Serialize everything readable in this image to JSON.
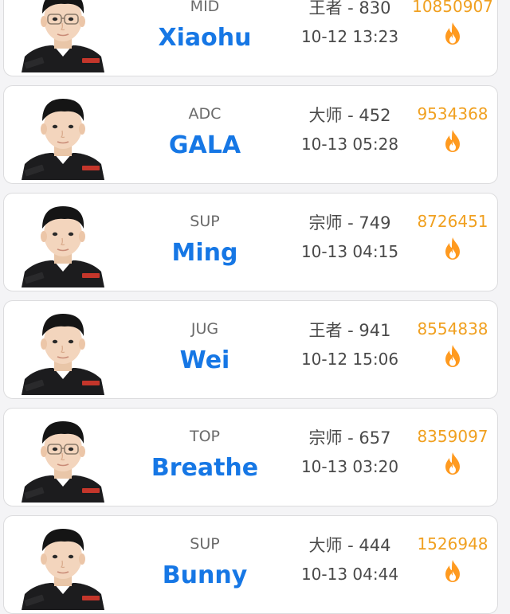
{
  "colors": {
    "name": "#1677e5",
    "score": "#f0a020",
    "fire": "#ff9a1f",
    "card_border": "#dcdcde"
  },
  "players": [
    {
      "role": "MID",
      "name": "Xiaohu",
      "rank": "王者 - 830",
      "time": "10-12 13:23",
      "score": "10850907",
      "icon": "fire-icon",
      "avatar": "player-photo"
    },
    {
      "role": "ADC",
      "name": "GALA",
      "rank": "大师 - 452",
      "time": "10-13 05:28",
      "score": "9534368",
      "icon": "fire-icon",
      "avatar": "player-photo"
    },
    {
      "role": "SUP",
      "name": "Ming",
      "rank": "宗师 - 749",
      "time": "10-13 04:15",
      "score": "8726451",
      "icon": "fire-icon",
      "avatar": "player-photo"
    },
    {
      "role": "JUG",
      "name": "Wei",
      "rank": "王者 - 941",
      "time": "10-12 15:06",
      "score": "8554838",
      "icon": "fire-icon",
      "avatar": "player-photo"
    },
    {
      "role": "TOP",
      "name": "Breathe",
      "rank": "宗师 - 657",
      "time": "10-13 03:20",
      "score": "8359097",
      "icon": "fire-icon",
      "avatar": "player-photo"
    },
    {
      "role": "SUP",
      "name": "Bunny",
      "rank": "大师 - 444",
      "time": "10-13 04:44",
      "score": "1526948",
      "icon": "fire-icon",
      "avatar": "player-photo"
    }
  ]
}
